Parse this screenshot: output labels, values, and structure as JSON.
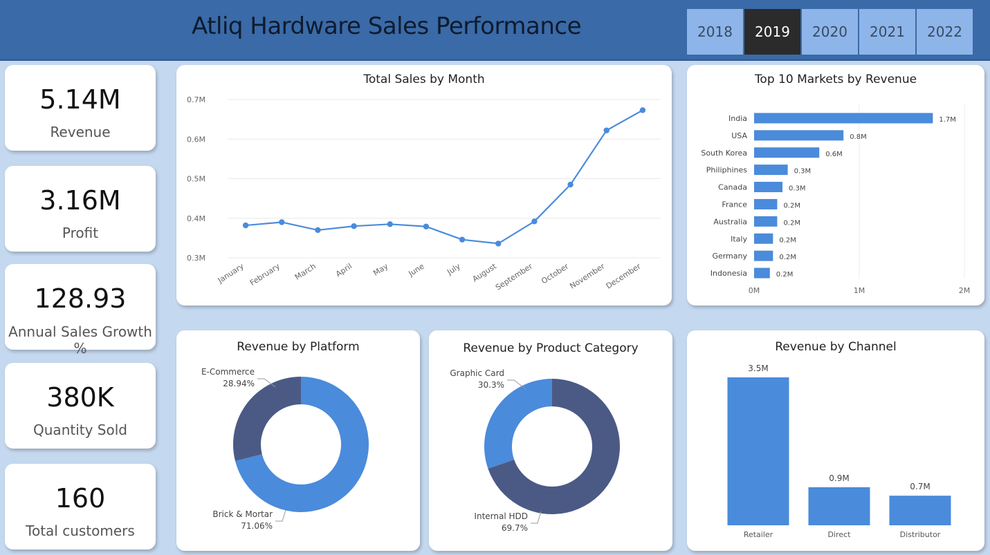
{
  "header": {
    "title": "Atliq Hardware Sales Performance",
    "years": [
      "2018",
      "2019",
      "2020",
      "2021",
      "2022"
    ],
    "active_year": "2019"
  },
  "kpis": [
    {
      "value": "5.14M",
      "label": "Revenue"
    },
    {
      "value": "3.16M",
      "label": "Profit"
    },
    {
      "value": "128.93",
      "label": "Annual Sales Growth %"
    },
    {
      "value": "380K",
      "label": "Quantity Sold"
    },
    {
      "value": "160",
      "label": "Total customers"
    }
  ],
  "colors": {
    "primary": "#4a8bdb",
    "secondary": "#4b5a85",
    "header": "#3a6aa7",
    "background": "#c4d8ef"
  },
  "chart_data": [
    {
      "type": "line",
      "title": "Total Sales by Month",
      "x": [
        "January",
        "February",
        "March",
        "April",
        "May",
        "June",
        "July",
        "August",
        "September",
        "October",
        "November",
        "December"
      ],
      "series": [
        {
          "values": [
            0.382,
            0.39,
            0.37,
            0.38,
            0.385,
            0.379,
            0.346,
            0.336,
            0.392,
            0.485,
            0.622,
            0.673
          ]
        }
      ],
      "yticks": [
        "0.3M",
        "0.4M",
        "0.5M",
        "0.6M",
        "0.7M"
      ],
      "ylim": [
        0.3,
        0.7
      ],
      "grid": true
    },
    {
      "type": "bar",
      "orientation": "horizontal",
      "title": "Top 10 Markets by Revenue",
      "categories": [
        "India",
        "USA",
        "South Korea",
        "Philiphines",
        "Canada",
        "France",
        "Australia",
        "Italy",
        "Germany",
        "Indonesia"
      ],
      "values": [
        1.7,
        0.85,
        0.62,
        0.32,
        0.27,
        0.22,
        0.22,
        0.18,
        0.18,
        0.15
      ],
      "labels": [
        "1.7M",
        "0.8M",
        "0.6M",
        "0.3M",
        "0.3M",
        "0.2M",
        "0.2M",
        "0.2M",
        "0.2M",
        "0.2M"
      ],
      "xticks": [
        "0M",
        "1M",
        "2M"
      ],
      "xlim": [
        0,
        2
      ]
    },
    {
      "type": "pie",
      "title": "Revenue by Platform",
      "slices": [
        {
          "name": "E-Commerce",
          "value": 28.94,
          "label": "28.94%",
          "color": "#4b5a85"
        },
        {
          "name": "Brick & Mortar",
          "value": 71.06,
          "label": "71.06%",
          "color": "#4a8bdb"
        }
      ]
    },
    {
      "type": "pie",
      "title": "Revenue by Product Category",
      "slices": [
        {
          "name": "Graphic Card",
          "value": 30.3,
          "label": "30.3%",
          "color": "#4a8bdb"
        },
        {
          "name": "Internal HDD",
          "value": 69.7,
          "label": "69.7%",
          "color": "#4b5a85"
        }
      ]
    },
    {
      "type": "bar",
      "title": "Revenue by Channel",
      "categories": [
        "Retailer",
        "Direct",
        "Distributor"
      ],
      "values": [
        3.5,
        0.9,
        0.7
      ],
      "labels": [
        "3.5M",
        "0.9M",
        "0.7M"
      ],
      "ylim": [
        0,
        3.5
      ]
    }
  ]
}
